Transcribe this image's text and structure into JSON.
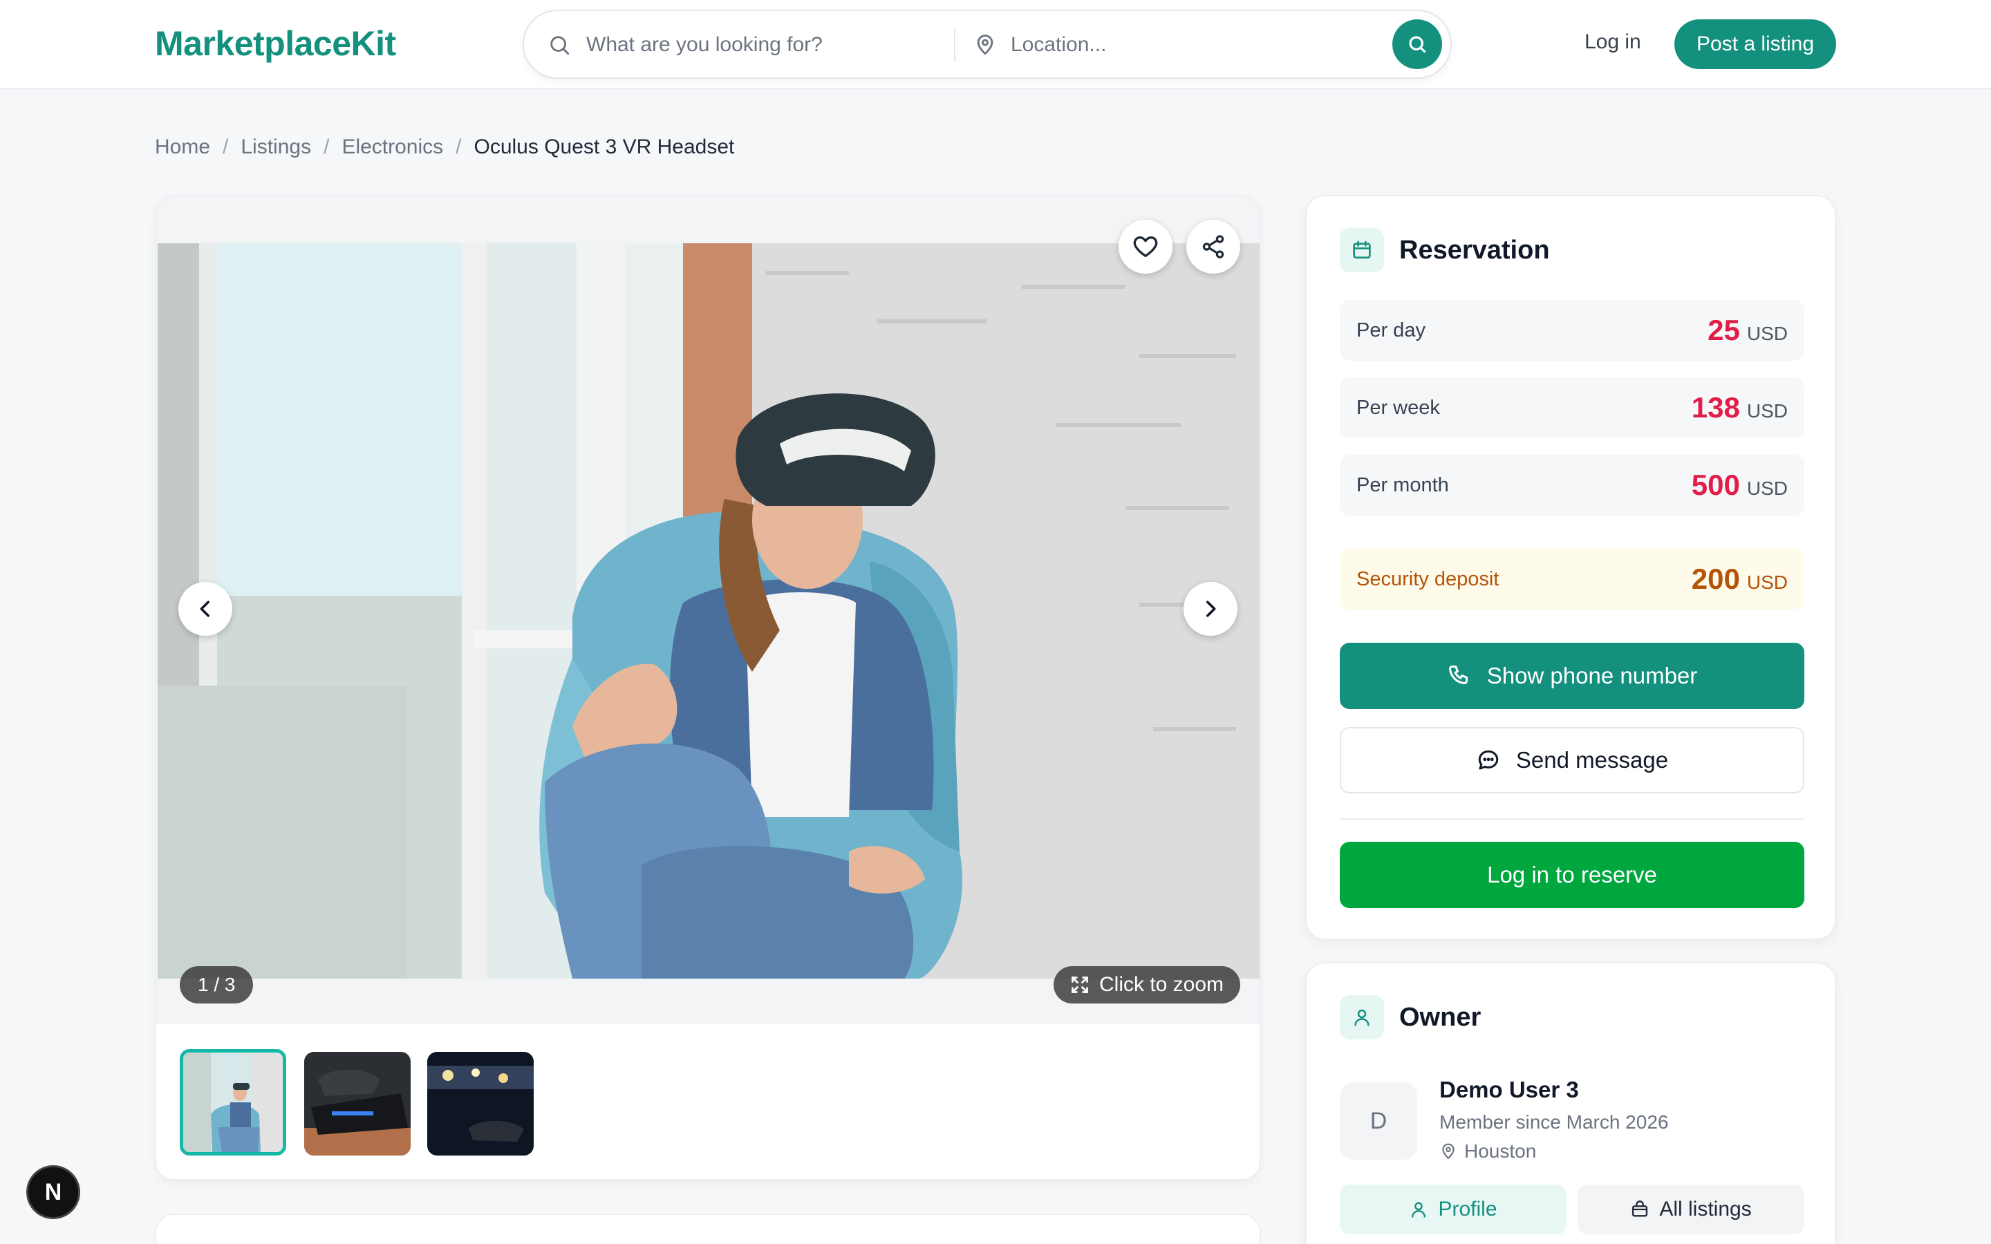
{
  "header": {
    "logo": "MarketplaceKit",
    "search_placeholder": "What are you looking for?",
    "location_placeholder": "Location...",
    "login": "Log in",
    "post_listing": "Post a listing"
  },
  "breadcrumb": {
    "home": "Home",
    "listings": "Listings",
    "category": "Electronics",
    "current": "Oculus Quest 3 VR Headset",
    "separator": "/"
  },
  "gallery": {
    "counter": "1 / 3",
    "zoom_label": "Click to zoom",
    "current_image": 1,
    "image_count": 3
  },
  "reservation": {
    "title": "Reservation",
    "prices": [
      {
        "label": "Per day",
        "amount": "25",
        "currency": "USD"
      },
      {
        "label": "Per week",
        "amount": "138",
        "currency": "USD"
      },
      {
        "label": "Per month",
        "amount": "500",
        "currency": "USD"
      }
    ],
    "deposit": {
      "label": "Security deposit",
      "amount": "200",
      "currency": "USD"
    },
    "show_phone": "Show phone number",
    "send_message": "Send message",
    "reserve": "Log in to reserve"
  },
  "owner": {
    "title": "Owner",
    "initial": "D",
    "name": "Demo User 3",
    "member_since": "Member since March 2026",
    "location": "Houston",
    "profile_btn": "Profile",
    "all_listings_btn": "All listings"
  },
  "dev_badge": "N",
  "colors": {
    "brand": "#14907f",
    "price": "#e11d48",
    "deposit": "#b45309",
    "reserve": "#00a63e"
  }
}
